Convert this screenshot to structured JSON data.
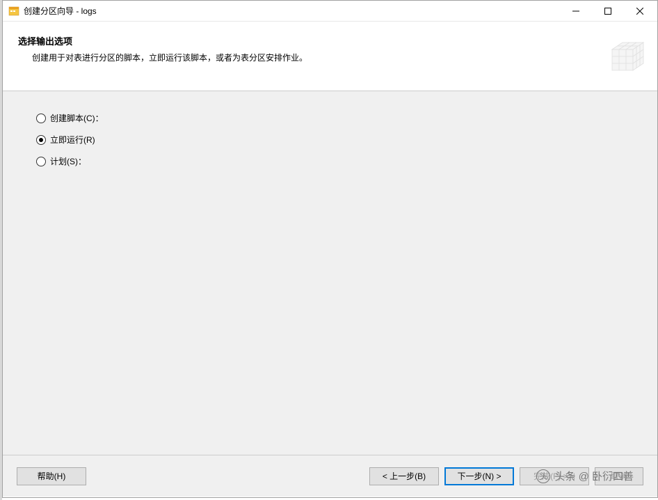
{
  "window": {
    "title": "创建分区向导 - logs"
  },
  "header": {
    "title": "选择输出选项",
    "subtitle": "创建用于对表进行分区的脚本，立即运行该脚本，或者为表分区安排作业。"
  },
  "options": {
    "create_script": "创建脚本(C)：",
    "run_now": "立即运行(R)",
    "schedule": "计划(S)："
  },
  "selected": "run_now",
  "buttons": {
    "help": "帮助(H)",
    "back": "< 上一步(B)",
    "next": "下一步(N) >",
    "finish": "完成(F) >>|",
    "cancel": "取消"
  },
  "watermark": "头条 @ 卧衍四善"
}
